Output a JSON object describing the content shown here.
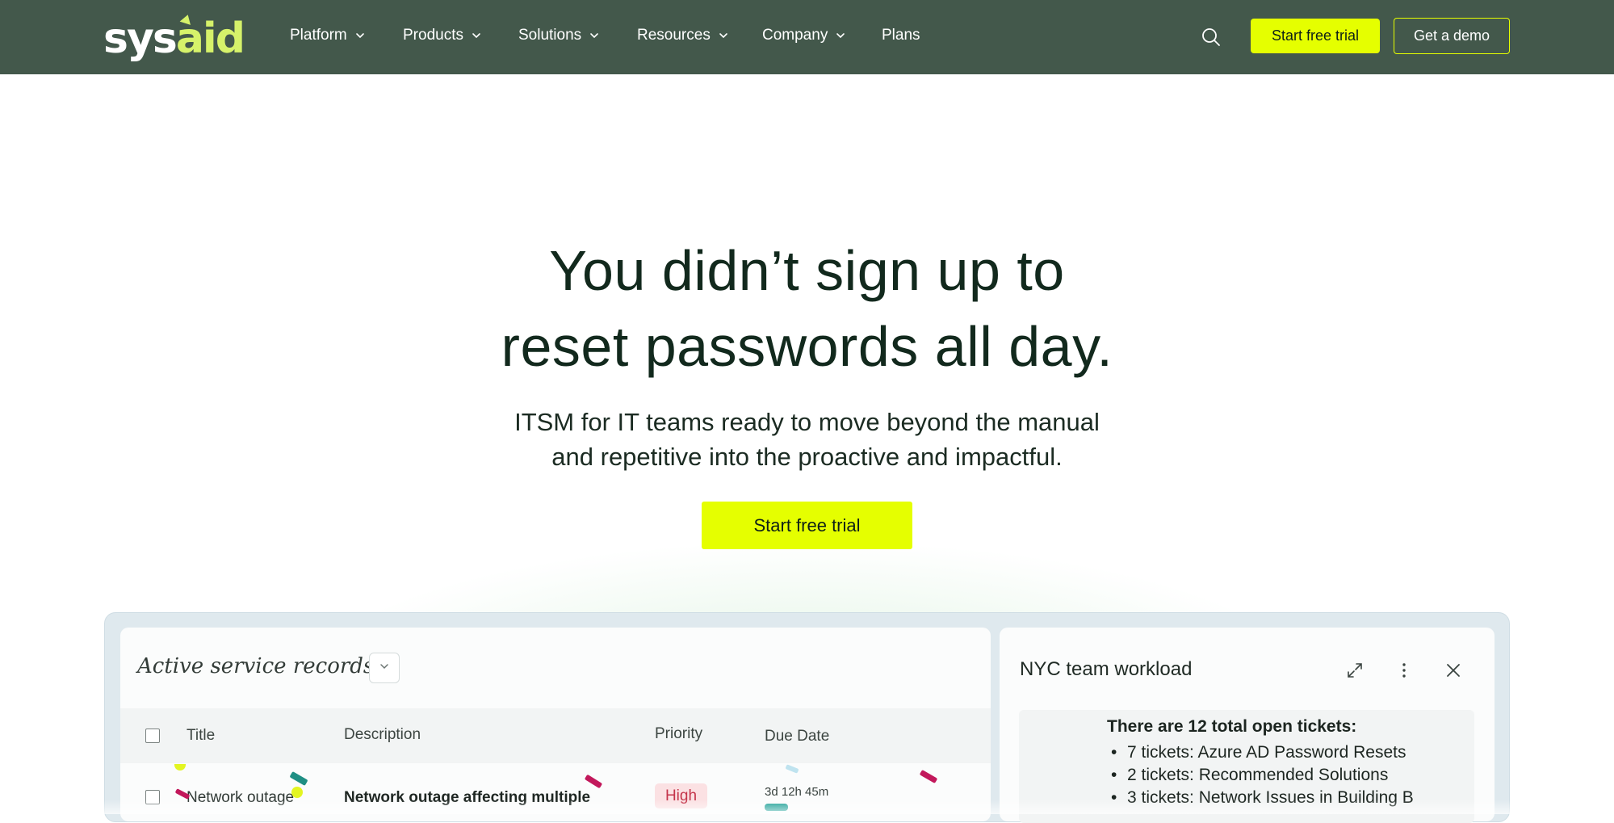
{
  "header": {
    "logo_main": "sys",
    "logo_accent": "aid",
    "nav": [
      {
        "label": "Platform",
        "has_dropdown": true
      },
      {
        "label": "Products",
        "has_dropdown": true
      },
      {
        "label": "Solutions",
        "has_dropdown": true
      },
      {
        "label": "Resources",
        "has_dropdown": true
      },
      {
        "label": "Company",
        "has_dropdown": true
      },
      {
        "label": "Plans",
        "has_dropdown": false
      }
    ],
    "search_icon": "search-icon",
    "trial_label": "Start free trial",
    "demo_label": "Get a demo"
  },
  "hero": {
    "title_line1": "You didn’t sign up to",
    "title_line2": "reset passwords all day.",
    "subtitle_line1": "ITSM for IT teams ready to move beyond the manual",
    "subtitle_line2": "and repetitive into the proactive and impactful.",
    "cta_label": "Start free trial"
  },
  "preview": {
    "records": {
      "title": "Active service records",
      "columns": [
        "Title",
        "Description",
        "Priority",
        "Due Date"
      ],
      "rows": [
        {
          "title": "Network outage",
          "description": "Network outage affecting multiple",
          "priority": "High",
          "due": "3d 12h 45m"
        }
      ]
    },
    "workload": {
      "title": "NYC team workload",
      "summary": "There are 12 total open tickets:",
      "items": [
        "7 tickets: Azure AD Password Resets",
        "2 tickets: Recommended Solutions",
        "3 tickets: Network Issues in Building B"
      ]
    }
  },
  "colors": {
    "header_bg": "#43584b",
    "accent": "#e5ff00",
    "logo_accent": "#d6f26a",
    "priority_high": "#c4344a"
  }
}
